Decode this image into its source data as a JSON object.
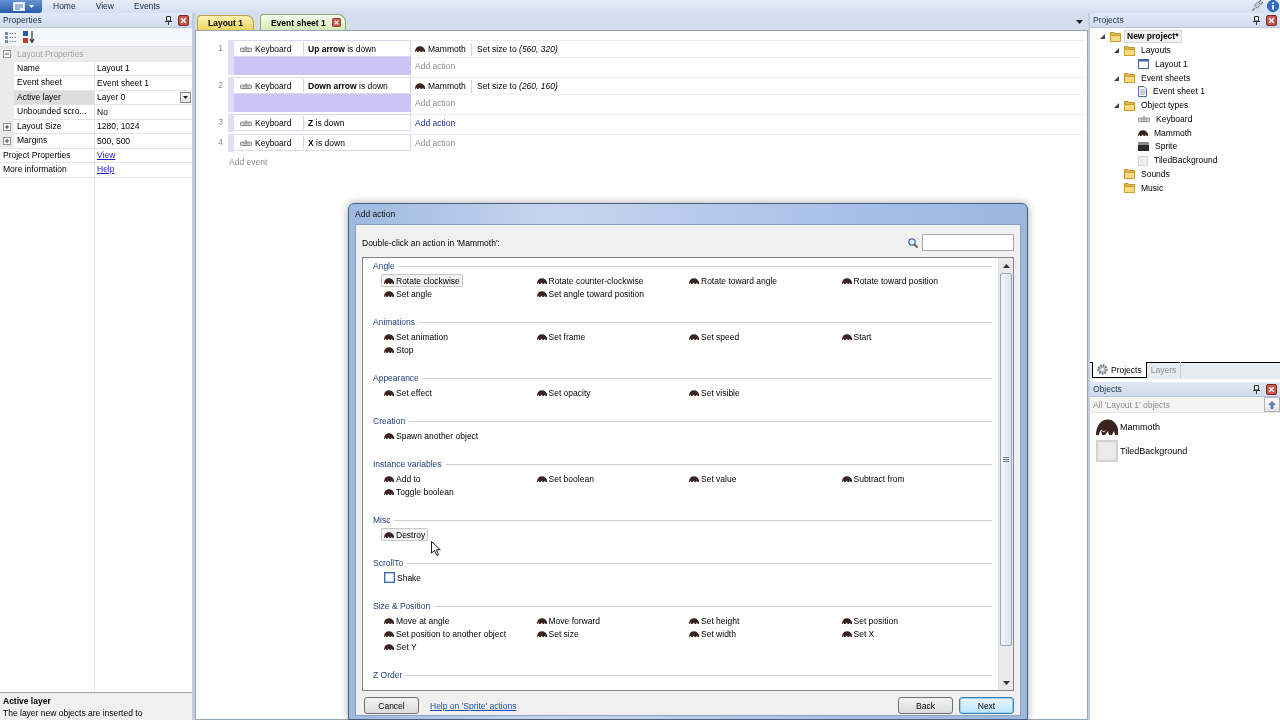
{
  "menu_bar": {
    "tabs": [
      "Home",
      "View",
      "Events"
    ]
  },
  "properties_panel": {
    "title": "Properties",
    "group": {
      "label": "Layout Properties",
      "expanded": true
    },
    "rows": [
      {
        "kind": "text",
        "name": "Name",
        "value": "Layout 1",
        "selected": false
      },
      {
        "kind": "text",
        "name": "Event sheet",
        "value": "Event sheet 1",
        "selected": false
      },
      {
        "kind": "dropdown",
        "name": "Active layer",
        "value": "Layer 0",
        "selected": true
      },
      {
        "kind": "text",
        "name": "Unbounded scro...",
        "value": "No",
        "selected": false
      },
      {
        "kind": "expandable",
        "name": "Layout Size",
        "value": "1280, 1024",
        "selected": false,
        "expanded": false
      },
      {
        "kind": "expandable",
        "name": "Margins",
        "value": "500, 500",
        "selected": false,
        "expanded": false
      }
    ],
    "links": [
      {
        "name": "Project Properties",
        "link": "View"
      },
      {
        "name": "More information",
        "link": "Help"
      }
    ],
    "description": {
      "title": "Active layer",
      "text": "The layer new objects are inserted to"
    }
  },
  "document_tabs": [
    {
      "label": "Layout 1",
      "kind": "layout",
      "selected": false
    },
    {
      "label": "Event sheet 1",
      "kind": "event_sheet",
      "selected": true
    }
  ],
  "event_sheet": {
    "events": [
      {
        "number": "1",
        "condition": {
          "object": "Keyboard",
          "text": "**Up arrow** is down"
        },
        "actions": [
          {
            "object": "Mammoth",
            "text": "Set size to *(560, 320)*"
          }
        ],
        "add_action": {
          "label": "Add action",
          "highlighted": false
        }
      },
      {
        "number": "2",
        "condition": {
          "object": "Keyboard",
          "text": "**Down arrow** is down"
        },
        "actions": [
          {
            "object": "Mammoth",
            "text": "Set size to *(260, 160)*"
          }
        ],
        "add_action": {
          "label": "Add action",
          "highlighted": false
        }
      },
      {
        "number": "3",
        "condition": {
          "object": "Keyboard",
          "text": "**Z** is down"
        },
        "add_action": {
          "label": "Add action",
          "highlighted": true
        }
      },
      {
        "number": "4",
        "condition": {
          "object": "Keyboard",
          "text": "**X** is down"
        },
        "add_action": {
          "label": "Add action",
          "highlighted": false
        }
      }
    ],
    "add_event": "Add event"
  },
  "dialog": {
    "title": "Add action",
    "prompt": "Double-click an action in 'Mammoth':",
    "categories": [
      {
        "name": "Angle",
        "actions": [
          {
            "label": "Rotate clockwise",
            "kind": "object",
            "highlighted": true
          },
          {
            "label": "Rotate counter-clockwise",
            "kind": "object",
            "highlighted": false
          },
          {
            "label": "Rotate toward angle",
            "kind": "object",
            "highlighted": false
          },
          {
            "label": "Rotate toward position",
            "kind": "object",
            "highlighted": false
          },
          {
            "label": "Set angle",
            "kind": "object",
            "highlighted": false
          },
          {
            "label": "Set angle toward position",
            "kind": "object",
            "highlighted": false
          }
        ]
      },
      {
        "name": "Animations",
        "actions": [
          {
            "label": "Set animation",
            "kind": "object",
            "highlighted": false
          },
          {
            "label": "Set frame",
            "kind": "object",
            "highlighted": false
          },
          {
            "label": "Set speed",
            "kind": "object",
            "highlighted": false
          },
          {
            "label": "Start",
            "kind": "object",
            "highlighted": false
          },
          {
            "label": "Stop",
            "kind": "object",
            "highlighted": false
          }
        ]
      },
      {
        "name": "Appearance",
        "actions": [
          {
            "label": "Set effect",
            "kind": "object",
            "highlighted": false
          },
          {
            "label": "Set opacity",
            "kind": "object",
            "highlighted": false
          },
          {
            "label": "Set visible",
            "kind": "object",
            "highlighted": false
          }
        ]
      },
      {
        "name": "Creation",
        "actions": [
          {
            "label": "Spawn another object",
            "kind": "object",
            "highlighted": false
          }
        ]
      },
      {
        "name": "Instance variables",
        "actions": [
          {
            "label": "Add to",
            "kind": "object",
            "highlighted": false
          },
          {
            "label": "Set boolean",
            "kind": "object",
            "highlighted": false
          },
          {
            "label": "Set value",
            "kind": "object",
            "highlighted": false
          },
          {
            "label": "Subtract from",
            "kind": "object",
            "highlighted": false
          },
          {
            "label": "Toggle boolean",
            "kind": "object",
            "highlighted": false
          }
        ]
      },
      {
        "name": "Misc",
        "actions": [
          {
            "label": "Destroy",
            "kind": "object",
            "highlighted": true
          }
        ]
      },
      {
        "name": "ScrollTo",
        "actions": [
          {
            "label": "Shake",
            "kind": "behavior",
            "highlighted": false
          }
        ]
      },
      {
        "name": "Size & Position",
        "actions": [
          {
            "label": "Move at angle",
            "kind": "object",
            "highlighted": false
          },
          {
            "label": "Move forward",
            "kind": "object",
            "highlighted": false
          },
          {
            "label": "Set height",
            "kind": "object",
            "highlighted": false
          },
          {
            "label": "Set position",
            "kind": "object",
            "highlighted": false
          },
          {
            "label": "Set position to another object",
            "kind": "object",
            "highlighted": false
          },
          {
            "label": "Set size",
            "kind": "object",
            "highlighted": false
          },
          {
            "label": "Set width",
            "kind": "object",
            "highlighted": false
          },
          {
            "label": "Set X",
            "kind": "object",
            "highlighted": false
          },
          {
            "label": "Set Y",
            "kind": "object",
            "highlighted": false
          }
        ]
      },
      {
        "name": "Z Order"
      }
    ],
    "footer": {
      "cancel": "Cancel",
      "help_link": "Help on 'Sprite' actions",
      "buttons": [
        {
          "label": "Back",
          "default": false
        },
        {
          "label": "Next",
          "default": true
        }
      ]
    }
  },
  "projects_panel": {
    "title": "Projects",
    "tree": [
      {
        "label": "New project*",
        "kind": "folder",
        "expanded": true,
        "selected": true,
        "children": [
          {
            "label": "Layouts",
            "kind": "folder",
            "expanded": true,
            "selected": false,
            "children": [
              {
                "label": "Layout 1",
                "kind": "layout",
                "selected": false
              }
            ]
          },
          {
            "label": "Event sheets",
            "kind": "folder",
            "expanded": true,
            "selected": false,
            "children": [
              {
                "label": "Event sheet 1",
                "kind": "event_sheet",
                "selected": false
              }
            ]
          },
          {
            "label": "Object types",
            "kind": "folder",
            "expanded": true,
            "selected": false,
            "children": [
              {
                "label": "Keyboard",
                "kind": "keyboard",
                "selected": false
              },
              {
                "label": "Mammoth",
                "kind": "mammoth",
                "selected": false
              },
              {
                "label": "Sprite",
                "kind": "sprite",
                "selected": false
              },
              {
                "label": "TiledBackground",
                "kind": "tiled",
                "selected": false
              }
            ]
          },
          {
            "label": "Sounds",
            "kind": "folder",
            "selected": false
          },
          {
            "label": "Music",
            "kind": "folder",
            "selected": false
          }
        ]
      }
    ]
  },
  "panel_tabs": [
    {
      "label": "Projects",
      "selected": true
    },
    {
      "label": "Layers",
      "selected": false
    }
  ],
  "objects_panel": {
    "title": "Objects",
    "filter": "All 'Layout 1' objects",
    "items": [
      {
        "label": "Mammoth",
        "kind": "mammoth"
      },
      {
        "label": "TiledBackground",
        "kind": "tiled"
      }
    ]
  }
}
